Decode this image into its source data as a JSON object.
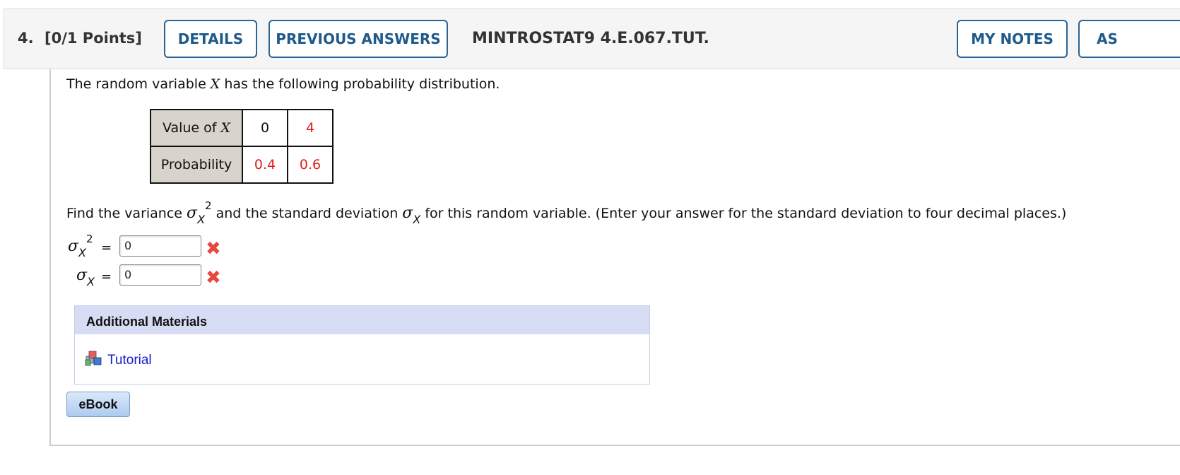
{
  "header": {
    "question_number": "4.",
    "points": "[0/1 Points]",
    "details_label": "DETAILS",
    "previous_answers_label": "PREVIOUS ANSWERS",
    "question_code": "MINTROSTAT9 4.E.067.TUT.",
    "my_notes_label": "MY NOTES",
    "ask_label_partial": "AS"
  },
  "problem": {
    "statement_prefix": "The random variable ",
    "statement_var": "X",
    "statement_suffix": " has the following probability distribution.",
    "table": {
      "row1_header_prefix": "Value of ",
      "row1_header_var": "X",
      "values": [
        "0",
        "4"
      ],
      "row2_header": "Probability",
      "probabilities": [
        "0.4",
        "0.6"
      ]
    },
    "question_part1": "Find the variance ",
    "question_part2": " and the standard deviation ",
    "question_part3": " for this random variable. (Enter your answer for the standard deviation to four decimal places.)",
    "sigma": "σ",
    "sub_x": "X",
    "sup_2": "2",
    "equals": "="
  },
  "answers": {
    "variance_value": "0",
    "std_value": "0",
    "incorrect_mark": "✖"
  },
  "materials": {
    "heading": "Additional Materials",
    "tutorial_label": "Tutorial"
  },
  "ebook_label": "eBook",
  "colors": {
    "button_border": "#2a6496",
    "incorrect": "#e8473f",
    "red_values": "#e01b1b",
    "link": "#1a1acc"
  }
}
